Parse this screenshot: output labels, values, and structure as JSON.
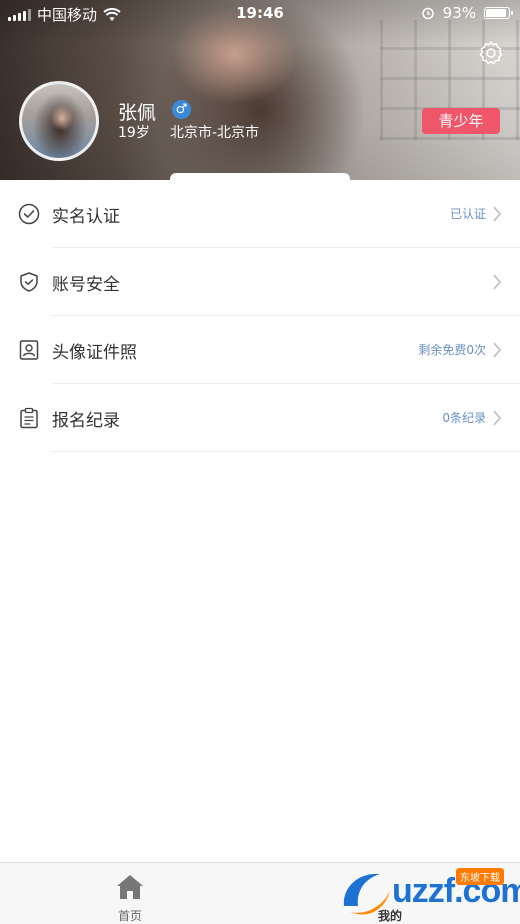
{
  "status_bar": {
    "carrier": "中国移动",
    "time": "19:46",
    "battery": "93%",
    "battery_level": 0.93
  },
  "profile": {
    "name": "张佩",
    "gender_symbol": "♂",
    "age": "19岁",
    "location": "北京市-北京市",
    "badge": "青少年"
  },
  "menu": {
    "items": [
      {
        "label": "实名认证",
        "value": "已认证",
        "icon": "check-circle-icon"
      },
      {
        "label": "账号安全",
        "value": "",
        "icon": "shield-icon"
      },
      {
        "label": "头像证件照",
        "value": "剩余免费0次",
        "icon": "id-photo-icon"
      },
      {
        "label": "报名纪录",
        "value": "0条纪录",
        "icon": "clipboard-icon"
      }
    ]
  },
  "tabs": [
    {
      "label": "首页",
      "icon": "home-icon"
    },
    {
      "label": "我的"
    }
  ],
  "watermark": {
    "text": "uzzf.com",
    "badge": "东坡下载"
  },
  "colors": {
    "accent_blue": "#6b8fc4",
    "teen_badge": "#f0566a",
    "gender_badge": "#3a8ad9"
  }
}
